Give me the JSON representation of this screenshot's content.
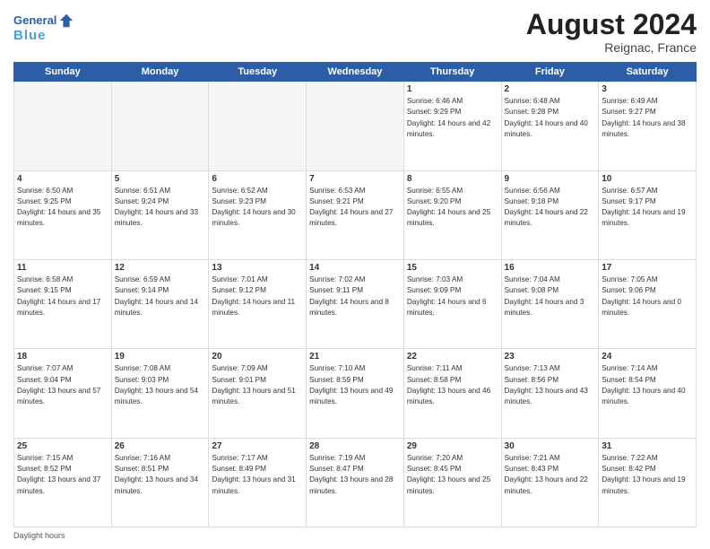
{
  "header": {
    "logo_line1": "General",
    "logo_line2": "Blue",
    "month_year": "August 2024",
    "location": "Reignac, France"
  },
  "days_of_week": [
    "Sunday",
    "Monday",
    "Tuesday",
    "Wednesday",
    "Thursday",
    "Friday",
    "Saturday"
  ],
  "weeks": [
    [
      {
        "num": "",
        "empty": true
      },
      {
        "num": "",
        "empty": true
      },
      {
        "num": "",
        "empty": true
      },
      {
        "num": "",
        "empty": true
      },
      {
        "num": "1",
        "sunrise": "6:46 AM",
        "sunset": "9:29 PM",
        "daylight": "14 hours and 42 minutes."
      },
      {
        "num": "2",
        "sunrise": "6:48 AM",
        "sunset": "9:28 PM",
        "daylight": "14 hours and 40 minutes."
      },
      {
        "num": "3",
        "sunrise": "6:49 AM",
        "sunset": "9:27 PM",
        "daylight": "14 hours and 38 minutes."
      }
    ],
    [
      {
        "num": "4",
        "sunrise": "6:50 AM",
        "sunset": "9:25 PM",
        "daylight": "14 hours and 35 minutes."
      },
      {
        "num": "5",
        "sunrise": "6:51 AM",
        "sunset": "9:24 PM",
        "daylight": "14 hours and 33 minutes."
      },
      {
        "num": "6",
        "sunrise": "6:52 AM",
        "sunset": "9:23 PM",
        "daylight": "14 hours and 30 minutes."
      },
      {
        "num": "7",
        "sunrise": "6:53 AM",
        "sunset": "9:21 PM",
        "daylight": "14 hours and 27 minutes."
      },
      {
        "num": "8",
        "sunrise": "6:55 AM",
        "sunset": "9:20 PM",
        "daylight": "14 hours and 25 minutes."
      },
      {
        "num": "9",
        "sunrise": "6:56 AM",
        "sunset": "9:18 PM",
        "daylight": "14 hours and 22 minutes."
      },
      {
        "num": "10",
        "sunrise": "6:57 AM",
        "sunset": "9:17 PM",
        "daylight": "14 hours and 19 minutes."
      }
    ],
    [
      {
        "num": "11",
        "sunrise": "6:58 AM",
        "sunset": "9:15 PM",
        "daylight": "14 hours and 17 minutes."
      },
      {
        "num": "12",
        "sunrise": "6:59 AM",
        "sunset": "9:14 PM",
        "daylight": "14 hours and 14 minutes."
      },
      {
        "num": "13",
        "sunrise": "7:01 AM",
        "sunset": "9:12 PM",
        "daylight": "14 hours and 11 minutes."
      },
      {
        "num": "14",
        "sunrise": "7:02 AM",
        "sunset": "9:11 PM",
        "daylight": "14 hours and 8 minutes."
      },
      {
        "num": "15",
        "sunrise": "7:03 AM",
        "sunset": "9:09 PM",
        "daylight": "14 hours and 6 minutes."
      },
      {
        "num": "16",
        "sunrise": "7:04 AM",
        "sunset": "9:08 PM",
        "daylight": "14 hours and 3 minutes."
      },
      {
        "num": "17",
        "sunrise": "7:05 AM",
        "sunset": "9:06 PM",
        "daylight": "14 hours and 0 minutes."
      }
    ],
    [
      {
        "num": "18",
        "sunrise": "7:07 AM",
        "sunset": "9:04 PM",
        "daylight": "13 hours and 57 minutes."
      },
      {
        "num": "19",
        "sunrise": "7:08 AM",
        "sunset": "9:03 PM",
        "daylight": "13 hours and 54 minutes."
      },
      {
        "num": "20",
        "sunrise": "7:09 AM",
        "sunset": "9:01 PM",
        "daylight": "13 hours and 51 minutes."
      },
      {
        "num": "21",
        "sunrise": "7:10 AM",
        "sunset": "8:59 PM",
        "daylight": "13 hours and 49 minutes."
      },
      {
        "num": "22",
        "sunrise": "7:11 AM",
        "sunset": "8:58 PM",
        "daylight": "13 hours and 46 minutes."
      },
      {
        "num": "23",
        "sunrise": "7:13 AM",
        "sunset": "8:56 PM",
        "daylight": "13 hours and 43 minutes."
      },
      {
        "num": "24",
        "sunrise": "7:14 AM",
        "sunset": "8:54 PM",
        "daylight": "13 hours and 40 minutes."
      }
    ],
    [
      {
        "num": "25",
        "sunrise": "7:15 AM",
        "sunset": "8:52 PM",
        "daylight": "13 hours and 37 minutes."
      },
      {
        "num": "26",
        "sunrise": "7:16 AM",
        "sunset": "8:51 PM",
        "daylight": "13 hours and 34 minutes."
      },
      {
        "num": "27",
        "sunrise": "7:17 AM",
        "sunset": "8:49 PM",
        "daylight": "13 hours and 31 minutes."
      },
      {
        "num": "28",
        "sunrise": "7:19 AM",
        "sunset": "8:47 PM",
        "daylight": "13 hours and 28 minutes."
      },
      {
        "num": "29",
        "sunrise": "7:20 AM",
        "sunset": "8:45 PM",
        "daylight": "13 hours and 25 minutes."
      },
      {
        "num": "30",
        "sunrise": "7:21 AM",
        "sunset": "8:43 PM",
        "daylight": "13 hours and 22 minutes."
      },
      {
        "num": "31",
        "sunrise": "7:22 AM",
        "sunset": "8:42 PM",
        "daylight": "13 hours and 19 minutes."
      }
    ]
  ],
  "footer": {
    "daylight_label": "Daylight hours"
  }
}
